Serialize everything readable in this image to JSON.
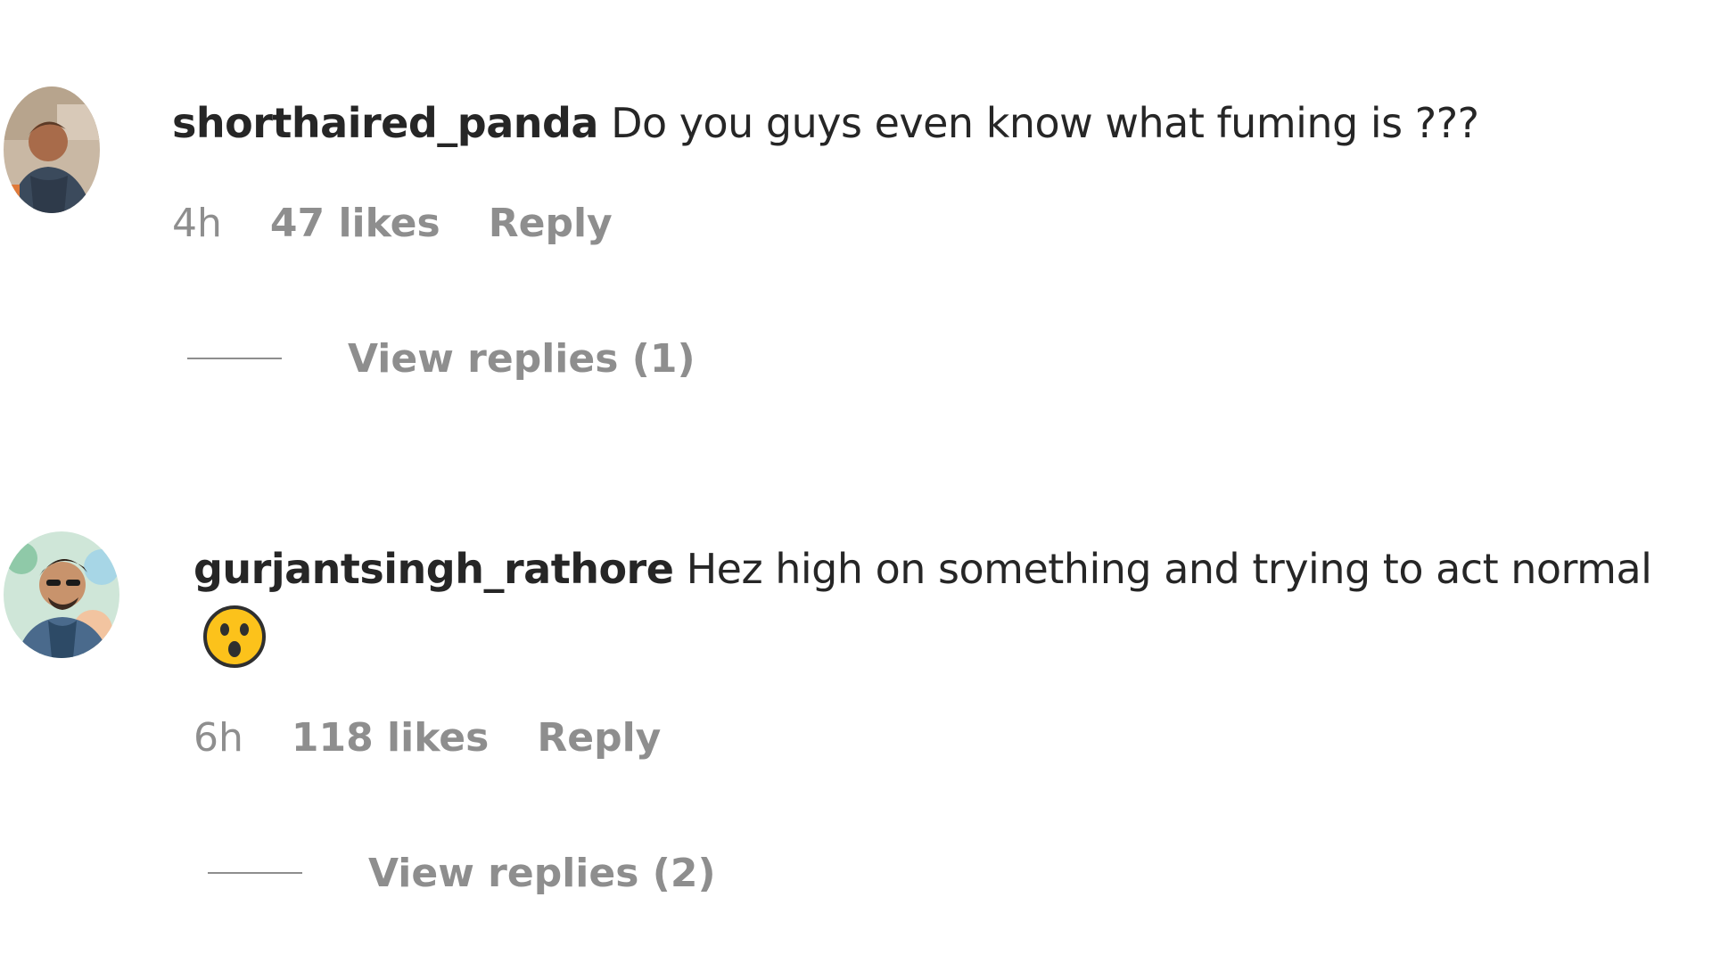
{
  "comments": [
    {
      "username": "shorthaired_panda",
      "text": "Do you guys even know what fuming is ???",
      "time": "4h",
      "likes": "47 likes",
      "reply_label": "Reply",
      "view_replies": "View replies (1)",
      "avatar_icon": "user-avatar-photo"
    },
    {
      "username": "gurjantsingh_rathore",
      "text": "Hez high on something and trying to act normal",
      "emoji": "astonished-face-emoji",
      "time": "6h",
      "likes": "118 likes",
      "reply_label": "Reply",
      "view_replies": "View replies (2)",
      "avatar_icon": "user-avatar-photo"
    }
  ],
  "colors": {
    "text": "#262626",
    "secondary": "#8e8e8e",
    "background": "#ffffff"
  }
}
